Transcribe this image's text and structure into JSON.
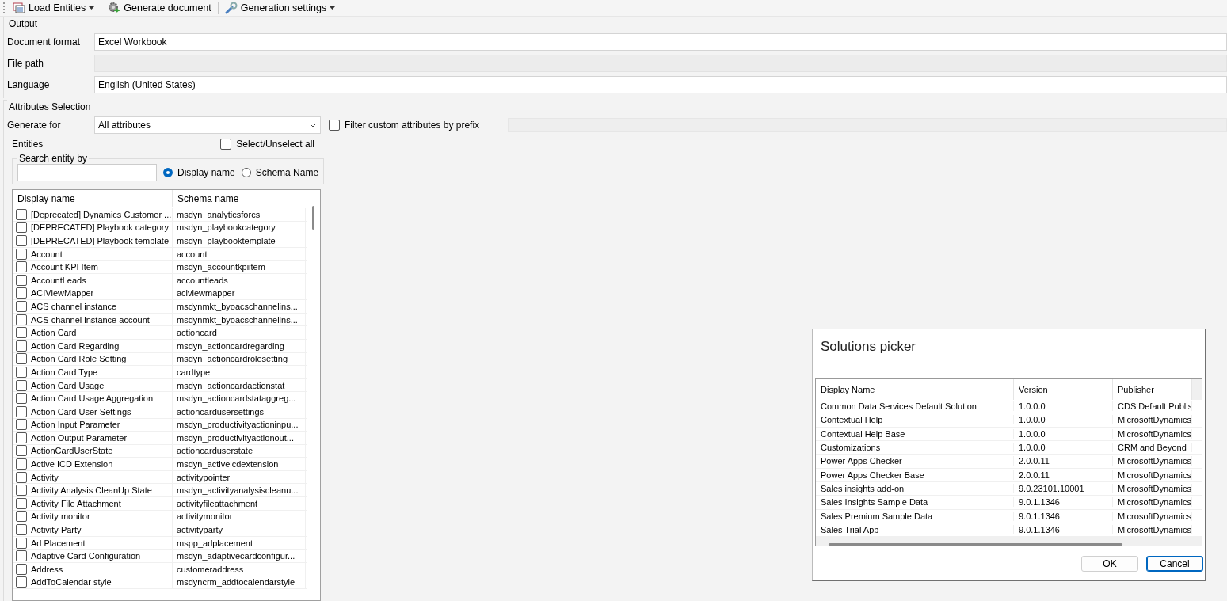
{
  "toolbar": {
    "buttons": [
      {
        "label": "Load Entities",
        "dropdown": true
      },
      {
        "label": "Generate document",
        "dropdown": false
      },
      {
        "label": "Generation settings",
        "dropdown": true
      }
    ]
  },
  "output": {
    "title": "Output",
    "fields": [
      {
        "label": "Document format",
        "value": "Excel Workbook",
        "disabled": false
      },
      {
        "label": "File path",
        "disabled": true
      },
      {
        "label": "Language",
        "value": "English (United States)",
        "disabled": false
      }
    ]
  },
  "attributes": {
    "title": "Attributes Selection",
    "generate_for": {
      "label": "Generate for",
      "value": "All attributes"
    },
    "filter_prefix": {
      "label": "Filter custom attributes by prefix",
      "checked": false,
      "field_disabled": true
    }
  },
  "entities": {
    "label": "Entities",
    "select_all": {
      "label": "Select/Unselect all",
      "checked": false
    },
    "search": {
      "title": "Search entity by"
    },
    "radios": [
      {
        "label": "Display name",
        "selected": true
      },
      {
        "label": "Schema Name",
        "selected": false
      }
    ],
    "table": {
      "columns": [
        "Display name",
        "Schema name"
      ],
      "rows": [
        {
          "display": "[Deprecated] Dynamics Customer ...",
          "schema": "msdyn_analyticsforcs",
          "checked": false
        },
        {
          "display": "[DEPRECATED] Playbook category",
          "schema": "msdyn_playbookcategory",
          "checked": false
        },
        {
          "display": "[DEPRECATED] Playbook template",
          "schema": "msdyn_playbooktemplate",
          "checked": false
        },
        {
          "display": "Account",
          "schema": "account",
          "checked": false
        },
        {
          "display": "Account KPI Item",
          "schema": "msdyn_accountkpiitem",
          "checked": false
        },
        {
          "display": "AccountLeads",
          "schema": "accountleads",
          "checked": false
        },
        {
          "display": "ACIViewMapper",
          "schema": "aciviewmapper",
          "checked": false
        },
        {
          "display": "ACS channel instance",
          "schema": "msdynmkt_byoacschannelins...",
          "checked": false
        },
        {
          "display": "ACS channel instance account",
          "schema": "msdynmkt_byoacschannelins...",
          "checked": false
        },
        {
          "display": "Action Card",
          "schema": "actioncard",
          "checked": false
        },
        {
          "display": "Action Card Regarding",
          "schema": "msdyn_actioncardregarding",
          "checked": false
        },
        {
          "display": "Action Card Role Setting",
          "schema": "msdyn_actioncardrolesetting",
          "checked": false
        },
        {
          "display": "Action Card Type",
          "schema": "cardtype",
          "checked": false
        },
        {
          "display": "Action Card Usage",
          "schema": "msdyn_actioncardactionstat",
          "checked": false
        },
        {
          "display": "Action Card Usage Aggregation",
          "schema": "msdyn_actioncardstataggreg...",
          "checked": false
        },
        {
          "display": "Action Card User Settings",
          "schema": "actioncardusersettings",
          "checked": false
        },
        {
          "display": "Action Input Parameter",
          "schema": "msdyn_productivityactioninpu...",
          "checked": false
        },
        {
          "display": "Action Output Parameter",
          "schema": "msdyn_productivityactionout...",
          "checked": false
        },
        {
          "display": "ActionCardUserState",
          "schema": "actioncarduserstate",
          "checked": false
        },
        {
          "display": "Active ICD Extension",
          "schema": "msdyn_activeicdextension",
          "checked": false
        },
        {
          "display": "Activity",
          "schema": "activitypointer",
          "checked": false
        },
        {
          "display": "Activity Analysis CleanUp State",
          "schema": "msdyn_activityanalysiscleanu...",
          "checked": false
        },
        {
          "display": "Activity File Attachment",
          "schema": "activityfileattachment",
          "checked": false
        },
        {
          "display": "Activity monitor",
          "schema": "activitymonitor",
          "checked": false
        },
        {
          "display": "Activity Party",
          "schema": "activityparty",
          "checked": false
        },
        {
          "display": "Ad Placement",
          "schema": "mspp_adplacement",
          "checked": false
        },
        {
          "display": "Adaptive Card Configuration",
          "schema": "msdyn_adaptivecardconfigur...",
          "checked": false
        },
        {
          "display": "Address",
          "schema": "customeraddress",
          "checked": false
        },
        {
          "display": "AddToCalendar style",
          "schema": "msdyncrm_addtocalendarstyle",
          "checked": false
        }
      ]
    }
  },
  "dialog": {
    "title": "Solutions picker",
    "columns": [
      "Display Name",
      "Version",
      "Publisher"
    ],
    "rows": [
      {
        "name": "Common Data Services Default Solution",
        "version": "1.0.0.0",
        "publisher": "CDS Default Publis"
      },
      {
        "name": "Contextual Help",
        "version": "1.0.0.0",
        "publisher": "MicrosoftDynamics"
      },
      {
        "name": "Contextual Help Base",
        "version": "1.0.0.0",
        "publisher": "MicrosoftDynamics"
      },
      {
        "name": "Customizations",
        "version": "1.0.0.0",
        "publisher": "CRM and Beyond"
      },
      {
        "name": "Power Apps Checker",
        "version": "2.0.0.11",
        "publisher": "MicrosoftDynamics"
      },
      {
        "name": "Power Apps Checker Base",
        "version": "2.0.0.11",
        "publisher": "MicrosoftDynamics"
      },
      {
        "name": "Sales insights add-on",
        "version": "9.0.23101.10001",
        "publisher": "MicrosoftDynamics"
      },
      {
        "name": "Sales Insights Sample Data",
        "version": "9.0.1.1346",
        "publisher": "MicrosoftDynamics"
      },
      {
        "name": "Sales Premium Sample Data",
        "version": "9.0.1.1346",
        "publisher": "MicrosoftDynamics"
      },
      {
        "name": "Sales Trial App",
        "version": "9.0.1.1346",
        "publisher": "MicrosoftDynamics"
      }
    ],
    "buttons": [
      {
        "label": "OK",
        "focused": false
      },
      {
        "label": "Cancel",
        "focused": true
      }
    ]
  }
}
